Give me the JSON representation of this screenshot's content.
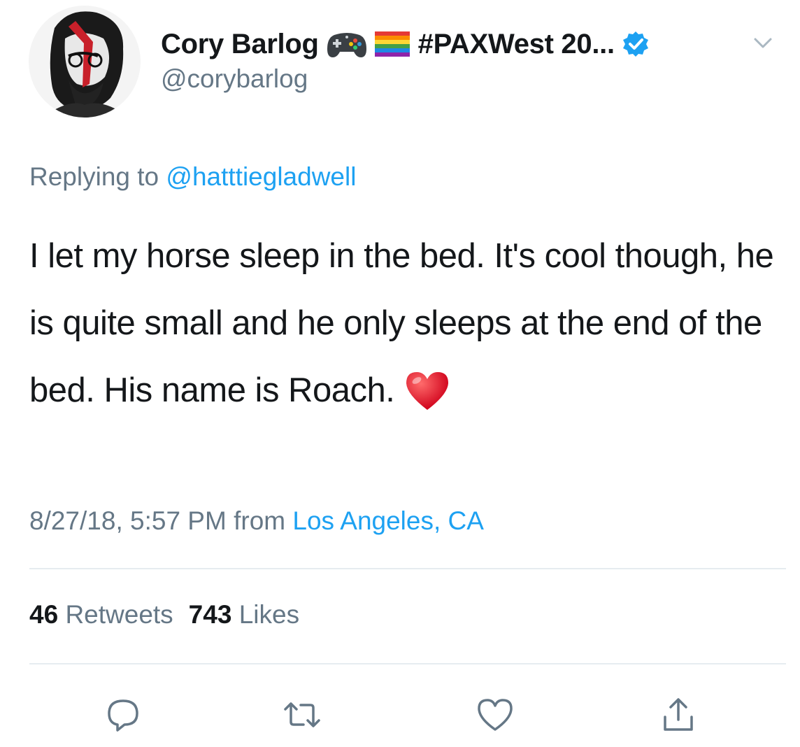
{
  "author": {
    "display_name": "Cory Barlog",
    "name_suffix": "#PAXWest 20...",
    "name_emojis": [
      "video-game-controller",
      "rainbow-flag"
    ],
    "handle": "@corybarlog",
    "verified": true
  },
  "reply": {
    "prefix": "Replying to",
    "mention": "@hatttiegladwell"
  },
  "tweet": {
    "text": "I let my horse sleep in the bed.  It's cool though, he is quite small and he only sleeps at the end of the bed. His name is Roach.",
    "trailing_emoji": "red-heart"
  },
  "meta": {
    "datetime": "8/27/18, 5:57 PM",
    "from_label": "from",
    "location": "Los Angeles, CA"
  },
  "stats": {
    "retweets_count": "46",
    "retweets_label": "Retweets",
    "likes_count": "743",
    "likes_label": "Likes"
  },
  "actions": {
    "icons": [
      "reply-icon",
      "retweet-icon",
      "like-icon",
      "share-icon"
    ]
  },
  "colors": {
    "text": "#14171a",
    "secondary": "#657786",
    "link": "#1da1f2",
    "divider": "#e6ecf0",
    "verified": "#1da1f2"
  }
}
